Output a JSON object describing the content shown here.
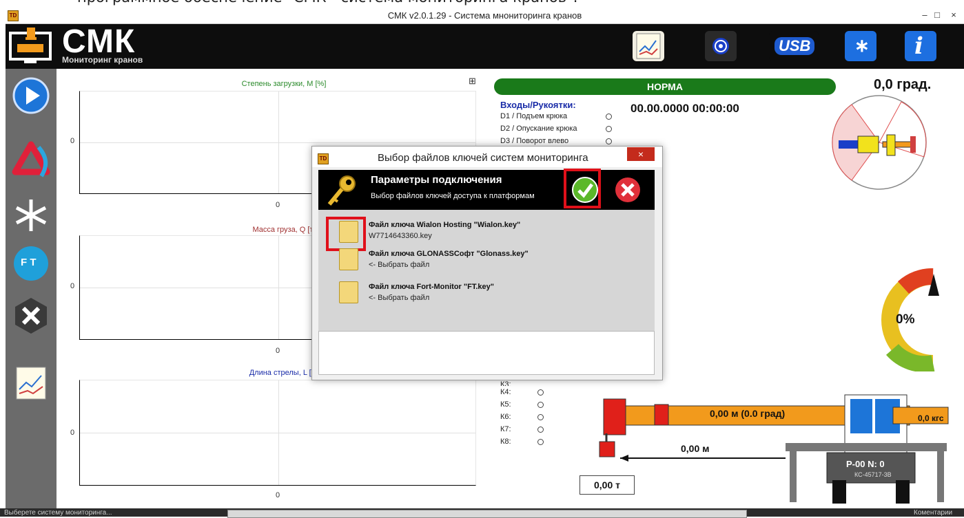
{
  "caption": "программное обеспечение \"СМК - система мониторинга кранов\".",
  "window": {
    "icon_text": "TD",
    "title": "СМК v2.0.1.29 - Система мнониторинга кранов",
    "controls": [
      "–",
      "□",
      "×"
    ]
  },
  "header": {
    "brand": "СМК",
    "subtitle": "Мониторинг кранов",
    "buttons": [
      "chart-icon",
      "target-icon",
      "usb-icon",
      "bluetooth-icon",
      "info-icon"
    ],
    "usb_label": "USB",
    "info_label": "i"
  },
  "sidebar": {
    "items": [
      "play-icon",
      "wialon-icon",
      "glonass-icon",
      "fort-monitor-icon",
      "tools-icon",
      "chart-report-icon"
    ],
    "ft_label": "F T"
  },
  "charts": [
    {
      "title": "Степень загрузки, M [%]",
      "title_color": "#2a8a2a",
      "y_tick": "0",
      "x_tick": "0"
    },
    {
      "title": "Масса груза, Q [т]",
      "title_color": "#a03030",
      "y_tick": "0",
      "x_tick": "0"
    },
    {
      "title": "Длина стрелы, L [м]",
      "title_color": "#1a2ca8",
      "y_tick": "0",
      "x_tick": "0"
    }
  ],
  "status": {
    "norm": "НОРМА",
    "angle": "0,0 град.",
    "datetime": "00.00.0000 00:00:00",
    "inputs_title": "Входы/Рукоятки:",
    "inputs": [
      {
        "label": "D1 / Подъем крюка"
      },
      {
        "label": "D2 / Опускание крюка"
      },
      {
        "label": "D3 / Поворот влево"
      }
    ],
    "k_partial": "К3:",
    "k_inputs": [
      "К4:",
      "К5:",
      "К6:",
      "К7:",
      "К8:"
    ],
    "gauge_pct": "0%"
  },
  "crane": {
    "boom": "0,00 м (0.0 град)",
    "force": "0,0 кгс",
    "radius": "0,00 м",
    "load": "0,00 т",
    "plate": "P-00  N: 0",
    "model": "КС-45717-3В"
  },
  "dialog": {
    "icon_text": "TD",
    "title": "Выбор файлов ключей систем мониторинга",
    "close": "×",
    "header_title": "Параметры подключения",
    "header_sub": "Выбор файлов ключей доступа к платформам",
    "keys": [
      {
        "title": "Файл ключа Wialon Hosting \"Wialon.key\"",
        "value": "W7714643360.key"
      },
      {
        "title": "Файл ключа GLONASSСофт \"Glonass.key\"",
        "value": "<- Выбрать файл"
      },
      {
        "title": "Файл ключа Fort-Monitor \"FT.key\"",
        "value": "<- Выбрать файл"
      }
    ]
  },
  "bottom": {
    "left": "Выберете систему мониторинга...",
    "right": "Коментарии"
  }
}
